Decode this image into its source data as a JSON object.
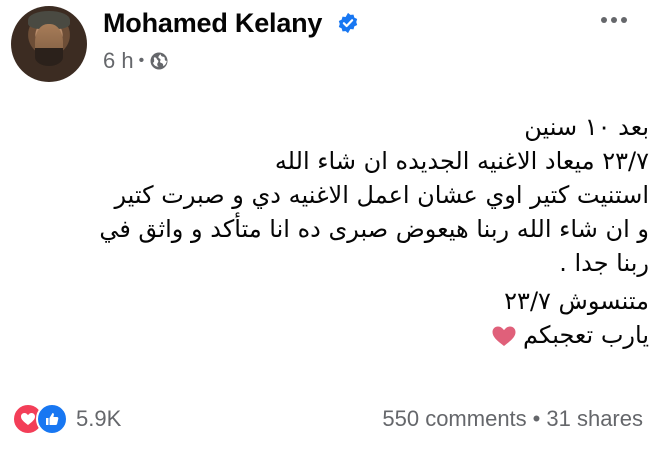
{
  "post": {
    "author": "Mohamed Kelany",
    "time": "6 h",
    "separator": "•",
    "lines": [
      "بعد ١٠ سنين",
      "٢٣/٧ ميعاد الاغنيه الجديده ان شاء الله",
      "استنيت كتير اوي عشان اعمل الاغنيه دي و صبرت كتير",
      "و ان شاء الله ربنا هيعوض صبرى ده انا متأكد و واثق في",
      "ربنا جدا .",
      "متنسوش ٢٣/٧",
      "يارب تعجبكم"
    ]
  },
  "footer": {
    "reaction_count": "5.9K",
    "comments": "550 comments",
    "dot": "•",
    "shares": "31 shares"
  },
  "colors": {
    "verified": "#1877f2",
    "secondary_text": "#65676b",
    "love": "#f33e58",
    "like": "#1877f2",
    "heart_emoji": "#e0607a"
  },
  "icons": [
    "verified-badge-icon",
    "globe-icon",
    "more-options-icon",
    "heart-emoji-icon",
    "love-reaction-icon",
    "like-reaction-icon"
  ]
}
